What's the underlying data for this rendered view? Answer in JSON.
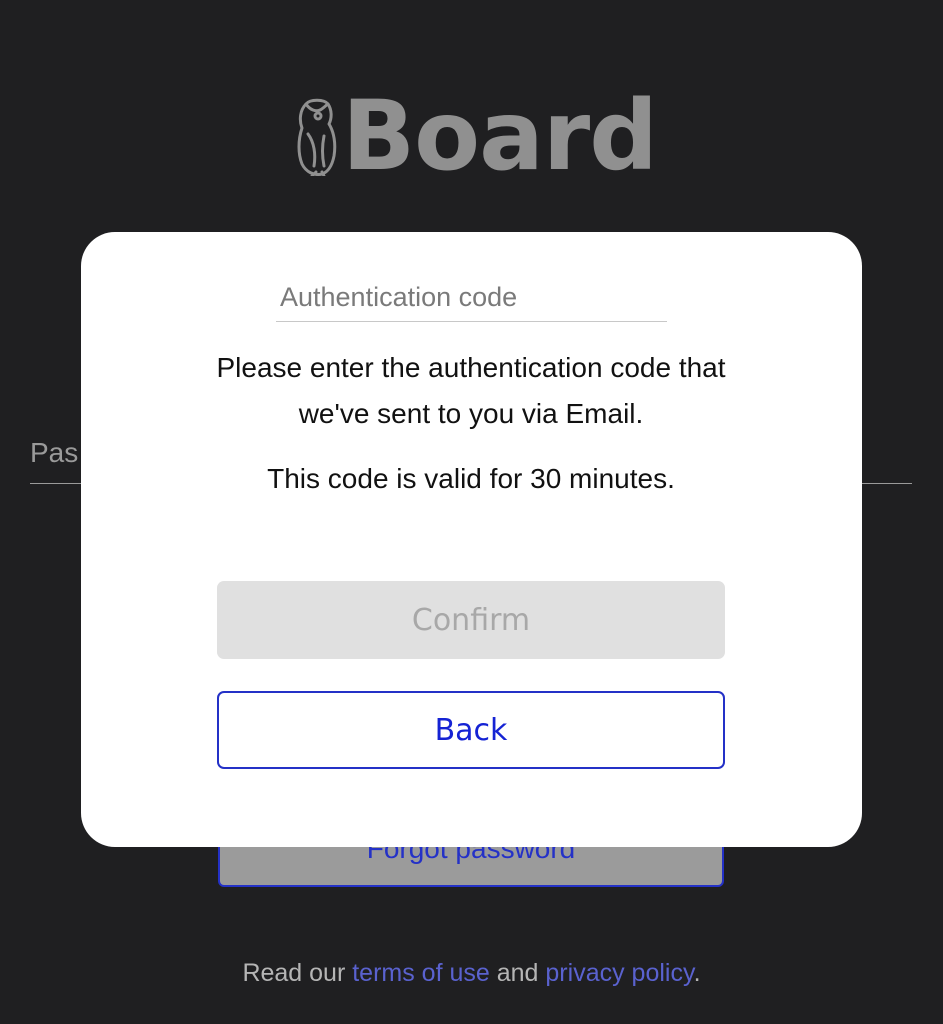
{
  "brand": {
    "logo_text": "Board",
    "logo_icon": "owl-icon"
  },
  "login": {
    "password_label": "Pas",
    "forgot_password_label": "Forgot password",
    "footer": {
      "prefix": "Read our ",
      "terms_link": "terms of use",
      "middle": " and ",
      "privacy_link": "privacy policy",
      "suffix": "."
    }
  },
  "dialog": {
    "auth_code_placeholder": "Authentication code",
    "auth_code_value": "",
    "instructions": "Please enter the authentication code that we've sent to you via Email.",
    "validity": "This code is valid for 30 minutes.",
    "confirm_label": "Confirm",
    "back_label": "Back"
  },
  "colors": {
    "background": "#1f1f21",
    "accent": "#2431c7",
    "link": "#5a62cf",
    "disabled_button": "#e0e0e0"
  }
}
